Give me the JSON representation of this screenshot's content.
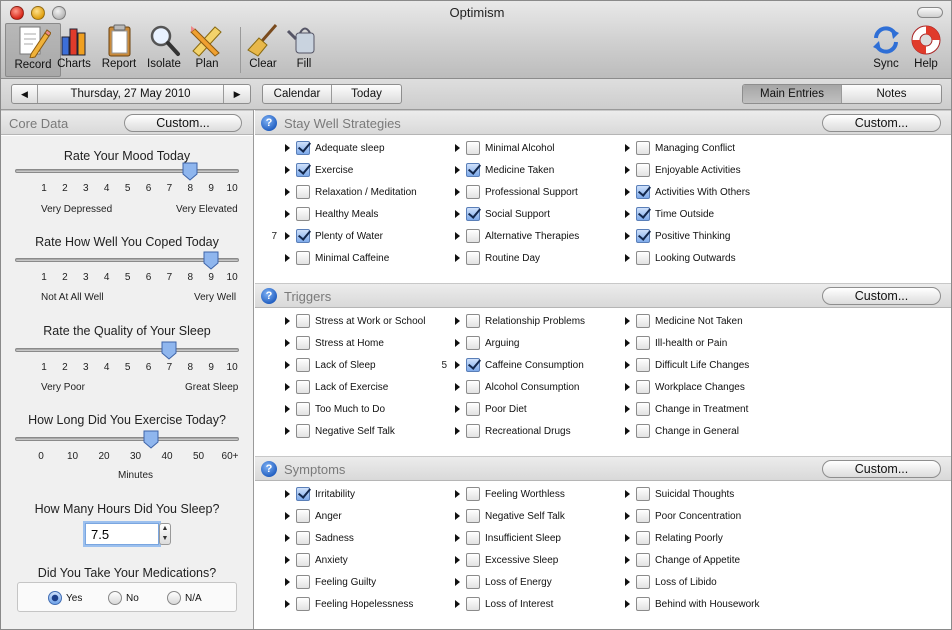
{
  "window": {
    "title": "Optimism"
  },
  "toolbar": [
    {
      "label": "Record",
      "icon": "record-pencil-icon",
      "active": true
    },
    {
      "label": "Charts",
      "icon": "bar-chart-icon",
      "active": false
    },
    {
      "label": "Report",
      "icon": "clipboard-icon",
      "active": false
    },
    {
      "label": "Isolate",
      "icon": "magnifier-icon",
      "active": false
    },
    {
      "label": "Plan",
      "icon": "pencil-ruler-icon",
      "active": false
    },
    {
      "label": "Clear",
      "icon": "broom-icon",
      "active": false
    },
    {
      "label": "Fill",
      "icon": "watering-can-icon",
      "active": false
    },
    {
      "label": "Sync",
      "icon": "sync-arrows-icon",
      "active": false
    },
    {
      "label": "Help",
      "icon": "lifebuoy-icon",
      "active": false
    }
  ],
  "nav": {
    "prev_icon": "◀",
    "date": "Thursday, 27 May 2010",
    "next_icon": "▶",
    "calendar": "Calendar",
    "today": "Today",
    "main_entries": "Main Entries",
    "notes": "Notes",
    "selected_view": "Main Entries"
  },
  "core_data": {
    "title": "Core Data",
    "custom": "Custom...",
    "mood": {
      "question": "Rate Your Mood Today",
      "ticks": [
        "1",
        "2",
        "3",
        "4",
        "5",
        "6",
        "7",
        "8",
        "9",
        "10"
      ],
      "value": 8,
      "min_label": "Very Depressed",
      "max_label": "Very Elevated"
    },
    "coped": {
      "question": "Rate How Well You Coped Today",
      "ticks": [
        "1",
        "2",
        "3",
        "4",
        "5",
        "6",
        "7",
        "8",
        "9",
        "10"
      ],
      "value": 9,
      "min_label": "Not At All Well",
      "max_label": "Very Well"
    },
    "sleep_quality": {
      "question": "Rate the Quality of Your Sleep",
      "ticks": [
        "1",
        "2",
        "3",
        "4",
        "5",
        "6",
        "7",
        "8",
        "9",
        "10"
      ],
      "value": 7,
      "min_label": "Very Poor",
      "max_label": "Great Sleep"
    },
    "exercise": {
      "question": "How Long Did You Exercise Today?",
      "ticks": [
        "0",
        "10",
        "20",
        "30",
        "40",
        "50",
        "60+"
      ],
      "value": 35,
      "unit": "Minutes"
    },
    "hours_sleep": {
      "question": "How Many Hours Did You Sleep?",
      "value": "7.5"
    },
    "medications": {
      "question": "Did You Take Your Medications?",
      "options": [
        "Yes",
        "No",
        "N/A"
      ],
      "selected": "Yes"
    }
  },
  "sections": [
    {
      "title": "Stay Well Strategies",
      "custom": "Custom...",
      "columns": [
        [
          {
            "label": "Adequate sleep",
            "checked": true
          },
          {
            "label": "Exercise",
            "checked": true
          },
          {
            "label": "Relaxation / Meditation",
            "checked": false
          },
          {
            "label": "Healthy Meals",
            "checked": false
          },
          {
            "label": "Plenty of Water",
            "checked": true,
            "count": "7"
          },
          {
            "label": "Minimal Caffeine",
            "checked": false
          }
        ],
        [
          {
            "label": "Minimal Alcohol",
            "checked": false
          },
          {
            "label": "Medicine Taken",
            "checked": true
          },
          {
            "label": "Professional Support",
            "checked": false
          },
          {
            "label": "Social Support",
            "checked": true
          },
          {
            "label": "Alternative Therapies",
            "checked": false
          },
          {
            "label": "Routine Day",
            "checked": false
          }
        ],
        [
          {
            "label": "Managing Conflict",
            "checked": false
          },
          {
            "label": "Enjoyable Activities",
            "checked": false
          },
          {
            "label": "Activities With Others",
            "checked": true
          },
          {
            "label": "Time Outside",
            "checked": true
          },
          {
            "label": "Positive Thinking",
            "checked": true
          },
          {
            "label": "Looking Outwards",
            "checked": false
          }
        ]
      ]
    },
    {
      "title": "Triggers",
      "custom": "Custom...",
      "columns": [
        [
          {
            "label": "Stress at Work or School",
            "checked": false
          },
          {
            "label": "Stress at Home",
            "checked": false
          },
          {
            "label": "Lack of Sleep",
            "checked": false
          },
          {
            "label": "Lack of Exercise",
            "checked": false
          },
          {
            "label": "Too Much to Do",
            "checked": false
          },
          {
            "label": "Negative Self Talk",
            "checked": false
          }
        ],
        [
          {
            "label": "Relationship Problems",
            "checked": false
          },
          {
            "label": "Arguing",
            "checked": false
          },
          {
            "label": "Caffeine Consumption",
            "checked": true,
            "count": "5"
          },
          {
            "label": "Alcohol Consumption",
            "checked": false
          },
          {
            "label": "Poor Diet",
            "checked": false
          },
          {
            "label": "Recreational Drugs",
            "checked": false
          }
        ],
        [
          {
            "label": "Medicine Not Taken",
            "checked": false
          },
          {
            "label": "Ill-health or Pain",
            "checked": false
          },
          {
            "label": "Difficult Life Changes",
            "checked": false
          },
          {
            "label": "Workplace Changes",
            "checked": false
          },
          {
            "label": "Change in Treatment",
            "checked": false
          },
          {
            "label": "Change in General",
            "checked": false
          }
        ]
      ]
    },
    {
      "title": "Symptoms",
      "custom": "Custom...",
      "columns": [
        [
          {
            "label": "Irritability",
            "checked": true
          },
          {
            "label": "Anger",
            "checked": false
          },
          {
            "label": "Sadness",
            "checked": false
          },
          {
            "label": "Anxiety",
            "checked": false
          },
          {
            "label": "Feeling Guilty",
            "checked": false
          },
          {
            "label": "Feeling Hopelessness",
            "checked": false
          }
        ],
        [
          {
            "label": "Feeling Worthless",
            "checked": false
          },
          {
            "label": "Negative Self Talk",
            "checked": false
          },
          {
            "label": "Insufficient Sleep",
            "checked": false
          },
          {
            "label": "Excessive Sleep",
            "checked": false
          },
          {
            "label": "Loss of Energy",
            "checked": false
          },
          {
            "label": "Loss of Interest",
            "checked": false
          }
        ],
        [
          {
            "label": "Suicidal Thoughts",
            "checked": false
          },
          {
            "label": "Poor Concentration",
            "checked": false
          },
          {
            "label": "Relating Poorly",
            "checked": false
          },
          {
            "label": "Change of Appetite",
            "checked": false
          },
          {
            "label": "Loss of Libido",
            "checked": false
          },
          {
            "label": "Behind with Housework",
            "checked": false
          }
        ]
      ]
    }
  ],
  "colors": {
    "accent": "#4a7fd0",
    "header_text": "#7a7a7a",
    "check": "#13284d"
  }
}
